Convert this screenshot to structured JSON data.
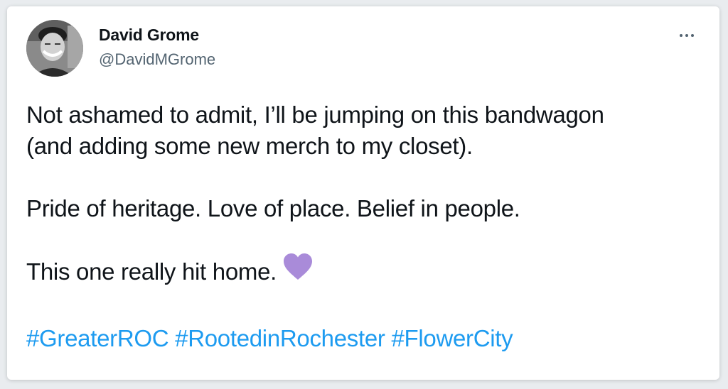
{
  "tweet": {
    "author": {
      "display_name": "David Grome",
      "handle": "@DavidMGrome",
      "avatar_icon": "profile-photo"
    },
    "more_icon": "more-horizontal-icon",
    "lines": [
      "Not ashamed to admit, I’ll be jumping on this bandwagon",
      "(and adding some new merch to my closet).",
      "Pride of heritage. Love of place. Belief in people.",
      "This one really hit home."
    ],
    "emoji": {
      "name": "purple-heart-icon",
      "color": "#a98bd9"
    },
    "hashtags": [
      "#GreaterROC",
      "#RootedinRochester",
      "#FlowerCity"
    ],
    "hashtag_color": "#1d9bf0"
  }
}
